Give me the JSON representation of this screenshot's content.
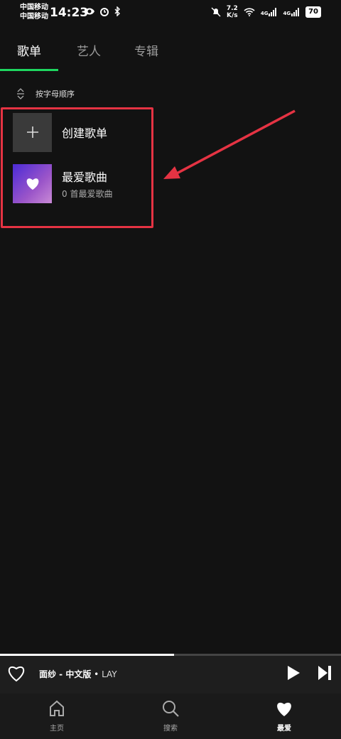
{
  "status_bar": {
    "carrier_1": "中国移动",
    "carrier_2": "中国移动",
    "time": "14:23",
    "net_speed_value": "7.2",
    "net_speed_unit": "K/s",
    "signal_1_label": "4G",
    "signal_2_label": "4G",
    "battery": "70"
  },
  "tabs": [
    {
      "label": "歌单",
      "active": true
    },
    {
      "label": "艺人",
      "active": false
    },
    {
      "label": "专辑",
      "active": false
    }
  ],
  "sort": {
    "label": "按字母顺序"
  },
  "items": [
    {
      "title": "创建歌单",
      "subtitle": "",
      "icon": "plus-icon"
    },
    {
      "title": "最爱歌曲",
      "subtitle": "0 首最爱歌曲",
      "icon": "heart-icon"
    }
  ],
  "player": {
    "song": "面纱 - 中文版",
    "separator": " • ",
    "artist": "LAY",
    "progress": 0.51
  },
  "nav": [
    {
      "label": "主页",
      "icon": "home-icon",
      "active": false
    },
    {
      "label": "搜索",
      "icon": "search-icon",
      "active": false
    },
    {
      "label": "最爱",
      "icon": "heart-icon",
      "active": true
    }
  ],
  "colors": {
    "accent": "#1ed760",
    "annotation": "#e53343",
    "background": "#121212"
  }
}
